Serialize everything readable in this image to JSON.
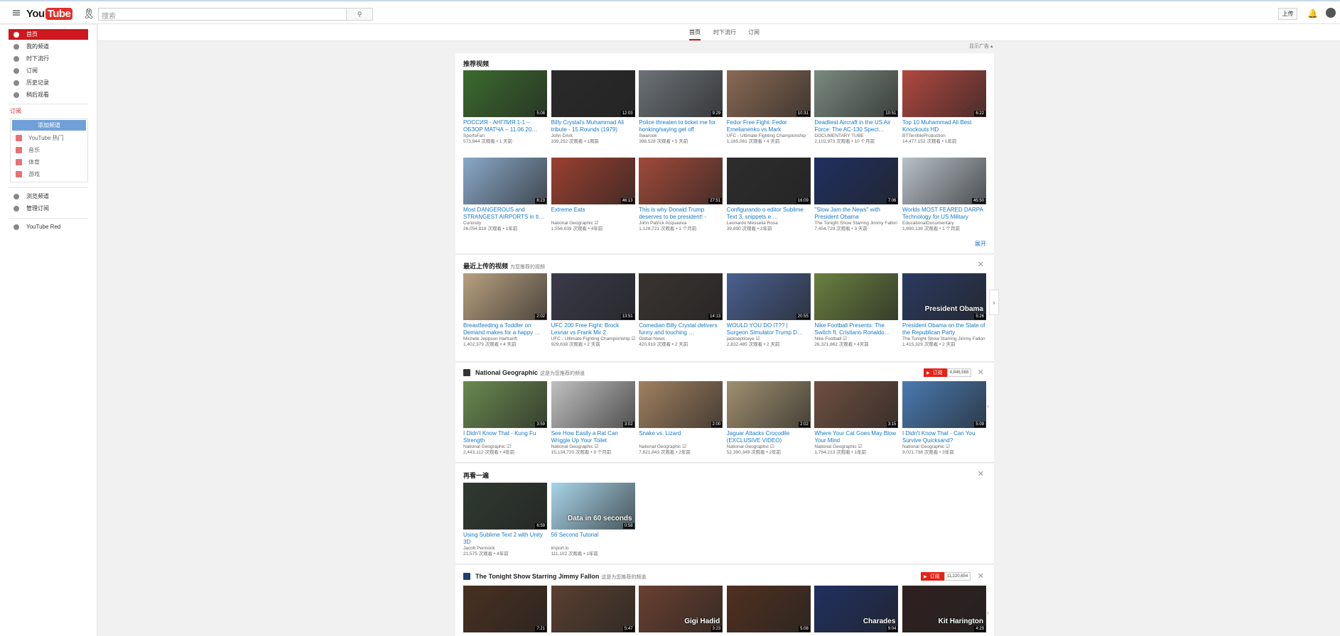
{
  "header": {
    "search_placeholder": "搜索",
    "search_icon": "search-icon",
    "upload_label": "上传"
  },
  "logo": {
    "you": "You",
    "tube": "Tube"
  },
  "nav": {
    "tabs": [
      "首页",
      "时下流行",
      "订阅"
    ],
    "ads_label": "显示广告 ▴"
  },
  "sidebar": {
    "items": [
      {
        "label": "首页",
        "icon": "home-icon"
      },
      {
        "label": "我的频道",
        "icon": "user-icon"
      },
      {
        "label": "时下流行",
        "icon": "flame-icon"
      },
      {
        "label": "订阅",
        "icon": "subscriptions-icon"
      },
      {
        "label": "历史记录",
        "icon": "history-icon"
      },
      {
        "label": "稍后观看",
        "icon": "clock-icon"
      }
    ],
    "subs_title": "订阅",
    "add_channels": "添加频道",
    "subs": [
      {
        "label": "YouTube 热门"
      },
      {
        "label": "音乐"
      },
      {
        "label": "体育"
      },
      {
        "label": "游戏"
      }
    ],
    "browse": "浏览频道",
    "manage": "管理订阅",
    "red": "YouTube Red"
  },
  "sections": {
    "rec": {
      "title": "推荐视频",
      "more": "展开",
      "row1": [
        {
          "title": "РОССИЯ - АНГЛИЯ 1-1 – ОБЗОР МАТЧА – 11.06.20…",
          "channel": "SportsFan",
          "meta": "573,844 次观看 • 1 天前",
          "dur": "5:08",
          "bg": "#3b6b2e"
        },
        {
          "title": "Billy Crystal's Muhammad Ali tribute - 15 Rounds (1979)",
          "channel": "John DArk",
          "meta": "339,252 次观看 • 1周前",
          "dur": "12:03",
          "bg": "#2a2a2a"
        },
        {
          "title": "Police threaten to ticket me for honking/saying get off",
          "channel": "Swarook",
          "meta": "398,528 次观看 • 5 天前",
          "dur": "9:29",
          "bg": "#6c7278"
        },
        {
          "title": "Fedor Free Fight: Fedor Emelianenko vs Mark",
          "channel": "UFC - Ultimate Fighting Championship",
          "meta": "1,165,081 次观看 • 4 天前",
          "dur": "10:31",
          "bg": "#8a6a55"
        },
        {
          "title": "Deadliest Aircraft in the US Air Force: The AC-130 Spect…",
          "channel": "DOCUMENTARY TUBE",
          "meta": "2,102,973 次观看 • 10 个月前",
          "dur": "10:51",
          "bg": "#7a8a80"
        },
        {
          "title": "Top 10 Muhammad Ali Best Knockouts HD",
          "channel": "BTTerribleProduction",
          "meta": "14,477,152 次观看 • 1年前",
          "dur": "6:22",
          "bg": "#b04840"
        }
      ],
      "row2": [
        {
          "title": "Most DANGEROUS and STRANGEST AIRPORTS in tl…",
          "channel": "Curiosity",
          "meta": "26,054,818 次观看 • 1年前",
          "dur": "8:23",
          "bg": "#8aa8c8"
        },
        {
          "title": "Extreme Eats",
          "channel": "National Geographic ☑",
          "meta": "1,556,639 次观看 • 4年前",
          "dur": "46:13",
          "bg": "#9a4030"
        },
        {
          "title": "This is why Donald Trump deserves to be president! -",
          "channel": "John Patrick Acquaviva",
          "meta": "1,128,721 次观看 • 1 个月前",
          "dur": "27:51",
          "bg": "#a04a3a"
        },
        {
          "title": "Configurando o editor Sublime Text 3, snippets e …",
          "channel": "Leonardo Messelia Rosa",
          "meta": "39,890 次观看 • 2年前",
          "dur": "16:09",
          "bg": "#2d2d2d"
        },
        {
          "title": "\"Slow Jam the News\" with President Obama",
          "channel": "The Tonight Show Starring Jimmy Fallon ☑",
          "meta": "7,454,729 次观看 • 3 天前",
          "dur": "7:06",
          "bg": "#203060"
        },
        {
          "title": "Worlds MOST FEARED DARPA Technology for US Military",
          "channel": "EducationalDocumentary",
          "meta": "1,690,138 次观看 • 1 个月前",
          "dur": "45:50",
          "bg": "#b8c0c8"
        }
      ]
    },
    "recent": {
      "title": "最近上传的视频",
      "subtitle": "为您推荐的视频",
      "row": [
        {
          "title": "Breastfeeding a Toddler on Demand makes for a happy …",
          "channel": "Michele Jeppson Hartranft",
          "meta": "1,402,379 次观看 • 4 天前",
          "dur": "2:02",
          "bg": "#b8a080"
        },
        {
          "title": "UFC 200 Free Fight: Brock Lesnar vs Frank Mir 2",
          "channel": "UFC - Ultimate Fighting Championship ☑",
          "meta": "929,638 次观看 • 2 天前",
          "dur": "13:51",
          "bg": "#3a3a4a"
        },
        {
          "title": "Comedian Billy Crystal delivers funny and touching …",
          "channel": "Global News",
          "meta": "420,919 次观看 • 2 天前",
          "dur": "14:13",
          "bg": "#3a3430"
        },
        {
          "title": "WOULD YOU DO IT?? | Surgeon Simulator Trump D…",
          "channel": "jacksepticeye ☑",
          "meta": "2,832,485 次观看 • 2 天前",
          "dur": "20:55",
          "bg": "#4a6090"
        },
        {
          "title": "Nike Football Presents: The Switch ft. Cristiano Ronaldo…",
          "channel": "Nike Football ☑",
          "meta": "26,321,862 次观看 • 4天前",
          "dur": "",
          "bg": "#6a8040"
        },
        {
          "title": "President Obama on the State of the Republican Party",
          "channel": "The Tonight Show Starring Jimmy Fallon ☑",
          "meta": "1,415,329 次观看 • 2 天前",
          "dur": "5:26",
          "bg": "#2a3a60",
          "cap": "President Obama"
        }
      ]
    },
    "natgeo": {
      "title": "National Geographic",
      "subtitle": "这是为您推荐的频道",
      "sub_label": "订阅",
      "sub_count": "4,846,568",
      "row": [
        {
          "title": "I Didn't Know That - Kung Fu Strength",
          "channel": "National Geographic ☑",
          "meta": "2,443,112 次观看 • 4年前",
          "dur": "3:59",
          "bg": "#6a8a50"
        },
        {
          "title": "See How Easily a Rat Can Wriggle Up Your Toilet",
          "channel": "National Geographic ☑",
          "meta": "15,134,720 次观看 • 9 个月前",
          "dur": "3:02",
          "bg": "#c0c0c0"
        },
        {
          "title": "Snake vs. Lizard",
          "channel": "National Geographic ☑",
          "meta": "7,621,843 次观看 • 2年前",
          "dur": "2:00",
          "bg": "#a08060"
        },
        {
          "title": "Jaguar Attacks Crocodile (EXCLUSIVE VIDEO)",
          "channel": "National Geographic ☑",
          "meta": "52,390,349 次观看 • 2年前",
          "dur": "2:02",
          "bg": "#a09070"
        },
        {
          "title": "Where Your Cat Goes May Blow Your Mind",
          "channel": "National Geographic ☑",
          "meta": "1,784,213 次观看 • 1年前",
          "dur": "3:15",
          "bg": "#705040"
        },
        {
          "title": "I Didn't Know That - Can You Survive Quicksand?",
          "channel": "National Geographic ☑",
          "meta": "9,021,738 次观看 • 3年前",
          "dur": "5:09",
          "bg": "#4a7ab0"
        }
      ]
    },
    "rewatch": {
      "title": "再看一遍",
      "row": [
        {
          "title": "Using Sublime Text 2 with Unity 3D",
          "channel": "Jacob Pennock",
          "meta": "21,575 次观看 • 4年前",
          "dur": "6:59",
          "bg": "#2f3a30"
        },
        {
          "title": "56 Second Tutorial",
          "channel": "import.io",
          "meta": "111,102 次观看 • 1年前",
          "dur": "0:58",
          "bg": "#a8d4e8",
          "cap": "Data in 60 seconds"
        }
      ]
    },
    "fallon": {
      "title": "The Tonight Show Starring Jimmy Fallon",
      "subtitle": "这是为您推荐的频道",
      "sub_label": "订阅",
      "sub_count": "11,220,654",
      "row": [
        {
          "dur": "7:21",
          "bg": "#4a3020"
        },
        {
          "dur": "5:47",
          "bg": "#5a4030"
        },
        {
          "dur": "3:23",
          "bg": "#6a4030",
          "cap": "Gigi Hadid"
        },
        {
          "dur": "5:08",
          "bg": "#503020"
        },
        {
          "dur": "9:04",
          "bg": "#203060",
          "cap": "Charades"
        },
        {
          "dur": "4:29",
          "bg": "#302020",
          "cap": "Kit Harington"
        }
      ]
    }
  }
}
